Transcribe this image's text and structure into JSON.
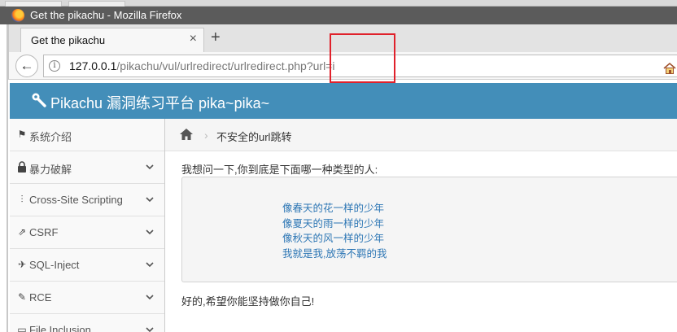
{
  "window": {
    "title": "Get the pikachu - Mozilla Firefox",
    "tab_title": "Get the pikachu",
    "tab_close": "×",
    "new_tab": "+"
  },
  "navbar": {
    "back": "←",
    "info": "i",
    "url_host": "127.0.0.1",
    "url_path": "/pikachu/vul/urlredirect/urlredirect.php?url=i"
  },
  "site": {
    "title": "Pikachu 漏洞练习平台 pika~pika~"
  },
  "sidebar": {
    "items": [
      {
        "label": "系统介绍",
        "icon": "tag-icon",
        "glyph": "⚑",
        "expandable": false
      },
      {
        "label": "暴力破解",
        "icon": "lock-icon",
        "glyph": "▲",
        "expandable": true
      },
      {
        "label": "Cross-Site Scripting",
        "icon": "sliders-icon",
        "glyph": "⫶",
        "expandable": true
      },
      {
        "label": "CSRF",
        "icon": "share-icon",
        "glyph": "⇗",
        "expandable": true
      },
      {
        "label": "SQL-Inject",
        "icon": "plane-icon",
        "glyph": "✈",
        "expandable": true
      },
      {
        "label": "RCE",
        "icon": "pencil-icon",
        "glyph": "✎",
        "expandable": true
      },
      {
        "label": "File Inclusion",
        "icon": "file-icon",
        "glyph": "▭",
        "expandable": true
      }
    ]
  },
  "breadcrumb": {
    "separator": "›",
    "current": "不安全的url跳转"
  },
  "content": {
    "question": "我想问一下,你到底是下面哪一种类型的人:",
    "options": [
      "像春天的花一样的少年",
      "像夏天的雨一样的少年",
      "像秋天的风一样的少年",
      "我就是我,放荡不羁的我"
    ],
    "result": "好的,希望你能坚持做你自己!"
  },
  "colors": {
    "header_bg": "#438eb9",
    "link": "#2e77b5",
    "highlight_box": "#e0212b"
  }
}
